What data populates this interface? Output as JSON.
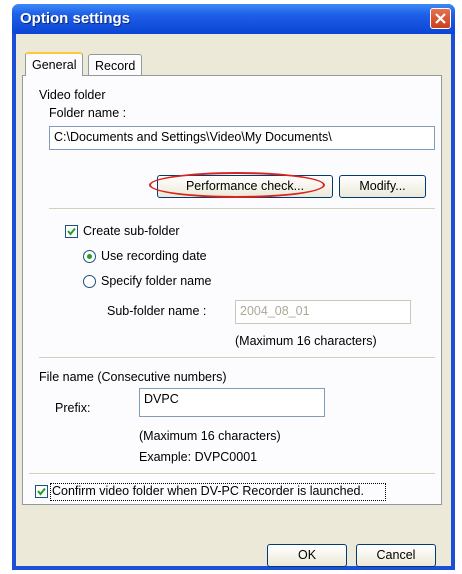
{
  "window": {
    "title": "Option settings"
  },
  "tabs": [
    {
      "label": "General",
      "active": true
    },
    {
      "label": "Record",
      "active": false
    }
  ],
  "video_folder": {
    "group_label": "Video folder",
    "folder_name_label": "Folder name :",
    "folder_name_value": "C:\\Documents and Settings\\Video\\My Documents\\",
    "performance_button": "Performance check...",
    "modify_button": "Modify..."
  },
  "sub_folder": {
    "create_label": "Create sub-folder",
    "create_checked": true,
    "use_date_label": "Use recording date",
    "use_date_selected": true,
    "specify_label": "Specify folder name",
    "specify_selected": false,
    "name_label": "Sub-folder name :",
    "name_value": "2004_08_01",
    "note": "(Maximum 16 characters)"
  },
  "file_name": {
    "group_label": "File name (Consecutive numbers)",
    "prefix_label": "Prefix:",
    "prefix_value": "DVPC",
    "note": "(Maximum 16 characters)",
    "example": "Example: DVPC0001"
  },
  "confirm": {
    "label": "Confirm video folder when DV-PC Recorder is launched.",
    "checked": true
  },
  "buttons": {
    "ok": "OK",
    "cancel": "Cancel"
  },
  "colors": {
    "highlight_ring": "#d8241c",
    "titlebar": "#0a46d4"
  }
}
